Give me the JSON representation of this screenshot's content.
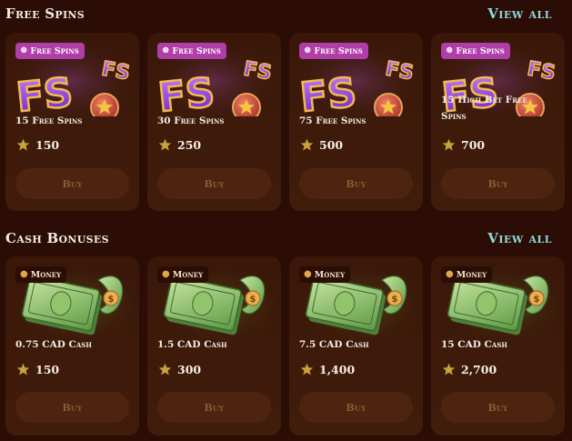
{
  "free_spins": {
    "title": "Free Spins",
    "view_all": "View all",
    "cards": [
      {
        "badge": "Free Spins",
        "badge_icon": "free-spins-icon",
        "name": "15 Free Spins",
        "price": "150",
        "buy": "Buy"
      },
      {
        "badge": "Free Spins",
        "badge_icon": "free-spins-icon",
        "name": "30 Free Spins",
        "price": "250",
        "buy": "Buy"
      },
      {
        "badge": "Free Spins",
        "badge_icon": "free-spins-icon",
        "name": "75 Free Spins",
        "price": "500",
        "buy": "Buy"
      },
      {
        "badge": "Free Spins",
        "badge_icon": "free-spins-icon",
        "name": "15 High Bet Free Spins",
        "price": "700",
        "buy": "Buy"
      }
    ]
  },
  "cash_bonuses": {
    "title": "Cash Bonuses",
    "view_all": "View all",
    "cards": [
      {
        "badge": "Money",
        "badge_icon": "money-icon",
        "name": "0.75 CAD Cash",
        "price": "150",
        "buy": "Buy"
      },
      {
        "badge": "Money",
        "badge_icon": "money-icon",
        "name": "1.5 CAD Cash",
        "price": "300",
        "buy": "Buy"
      },
      {
        "badge": "Money",
        "badge_icon": "money-icon",
        "name": "7.5 CAD Cash",
        "price": "1,400",
        "buy": "Buy"
      },
      {
        "badge": "Money",
        "badge_icon": "money-icon",
        "name": "15 CAD Cash",
        "price": "2,700",
        "buy": "Buy"
      }
    ]
  },
  "colors": {
    "background": "#2b0d05",
    "card": "#3d1a0a",
    "view_all": "#8fd9dc",
    "badge_free_spins": "#b03ea8",
    "buy_button": "#4d2410",
    "star": "#c9a23a"
  },
  "icons": {
    "price": "star-icon",
    "fs_art": "free-spins-art",
    "cash_art": "cash-art"
  }
}
